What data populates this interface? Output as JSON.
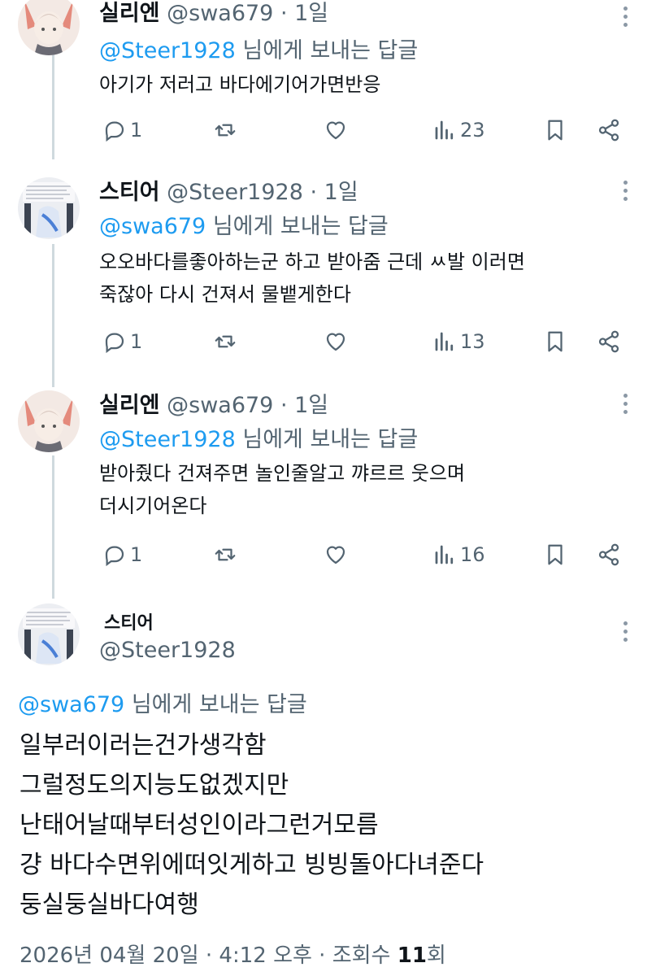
{
  "tweets": [
    {
      "name": "실리엔",
      "handle": "@swa679",
      "sep": " · ",
      "time": "1일",
      "reply_mention": "@Steer1928",
      "reply_suffix": " 님에게 보내는 답글",
      "text": "아기가 저러고 바다에기어가면반응",
      "replies": "1",
      "views": "23"
    },
    {
      "name": "스티어",
      "handle": "@Steer1928",
      "sep": " · ",
      "time": "1일",
      "reply_mention": "@swa679",
      "reply_suffix": " 님에게 보내는 답글",
      "text": "오오바다를좋아하는군 하고 받아줌 근데 ㅆ발 이러면\n죽잖아 다시 건져서 물뱉게한다",
      "replies": "1",
      "views": "13"
    },
    {
      "name": "실리엔",
      "handle": "@swa679",
      "sep": " · ",
      "time": "1일",
      "reply_mention": "@Steer1928",
      "reply_suffix": " 님에게 보내는 답글",
      "text": "받아줬다 건져주면 놀인줄알고 꺄르르 웃으며\n더시기어온다",
      "replies": "1",
      "views": "16"
    }
  ],
  "main": {
    "name": "스티어",
    "handle": "@Steer1928",
    "reply_mention": "@swa679",
    "reply_suffix": " 님에게 보내는 답글",
    "text": "일부러이러는건가생각함\n그럴정도의지능도없겠지만\n난태어날때부터성인이라그런거모름\n걍 바다수면위에떠잇게하고 빙빙돌아다녀준다\n둥실둥실바다여행",
    "meta_date": "2026년 04월 20일 · 4:12 오후 · 조회수 ",
    "meta_views": "11",
    "meta_views_unit": "회"
  },
  "colors": {
    "accent": "#1d9bf0",
    "secondary_text": "#536471",
    "thread_line": "#cfd9de"
  },
  "icons": [
    "reply-icon",
    "retweet-icon",
    "like-icon",
    "views-icon",
    "bookmark-icon",
    "share-icon",
    "more-icon"
  ]
}
